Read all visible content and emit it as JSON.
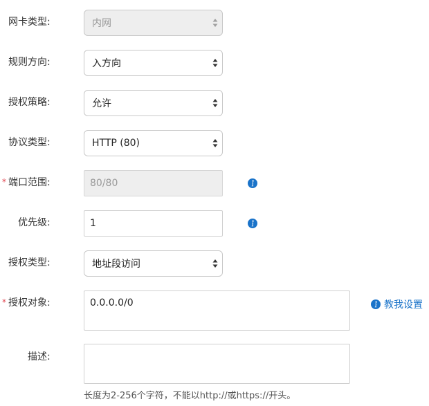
{
  "form": {
    "nic_type": {
      "label": "网卡类型:",
      "value": "内网"
    },
    "rule_direction": {
      "label": "规则方向:",
      "value": "入方向"
    },
    "auth_policy": {
      "label": "授权策略:",
      "value": "允许"
    },
    "protocol_type": {
      "label": "协议类型:",
      "value": "HTTP (80)"
    },
    "port_range": {
      "label": "端口范围:",
      "value": "80/80",
      "required_mark": "*"
    },
    "priority": {
      "label": "优先级:",
      "value": "1"
    },
    "auth_type": {
      "label": "授权类型:",
      "value": "地址段访问"
    },
    "auth_object": {
      "label": "授权对象:",
      "value": "0.0.0.0/0",
      "required_mark": "*",
      "help_link": "教我设置"
    },
    "description": {
      "label": "描述:",
      "value": "",
      "hint": "长度为2-256个字符，不能以http://或https://开头。"
    }
  },
  "icons": {
    "info": "info-icon",
    "select_arrows": "updown-arrows-icon"
  },
  "colors": {
    "required": "#e0434d",
    "link": "#1a73c9",
    "info_icon": "#1a73c9",
    "disabled_bg": "#eeeeee"
  }
}
